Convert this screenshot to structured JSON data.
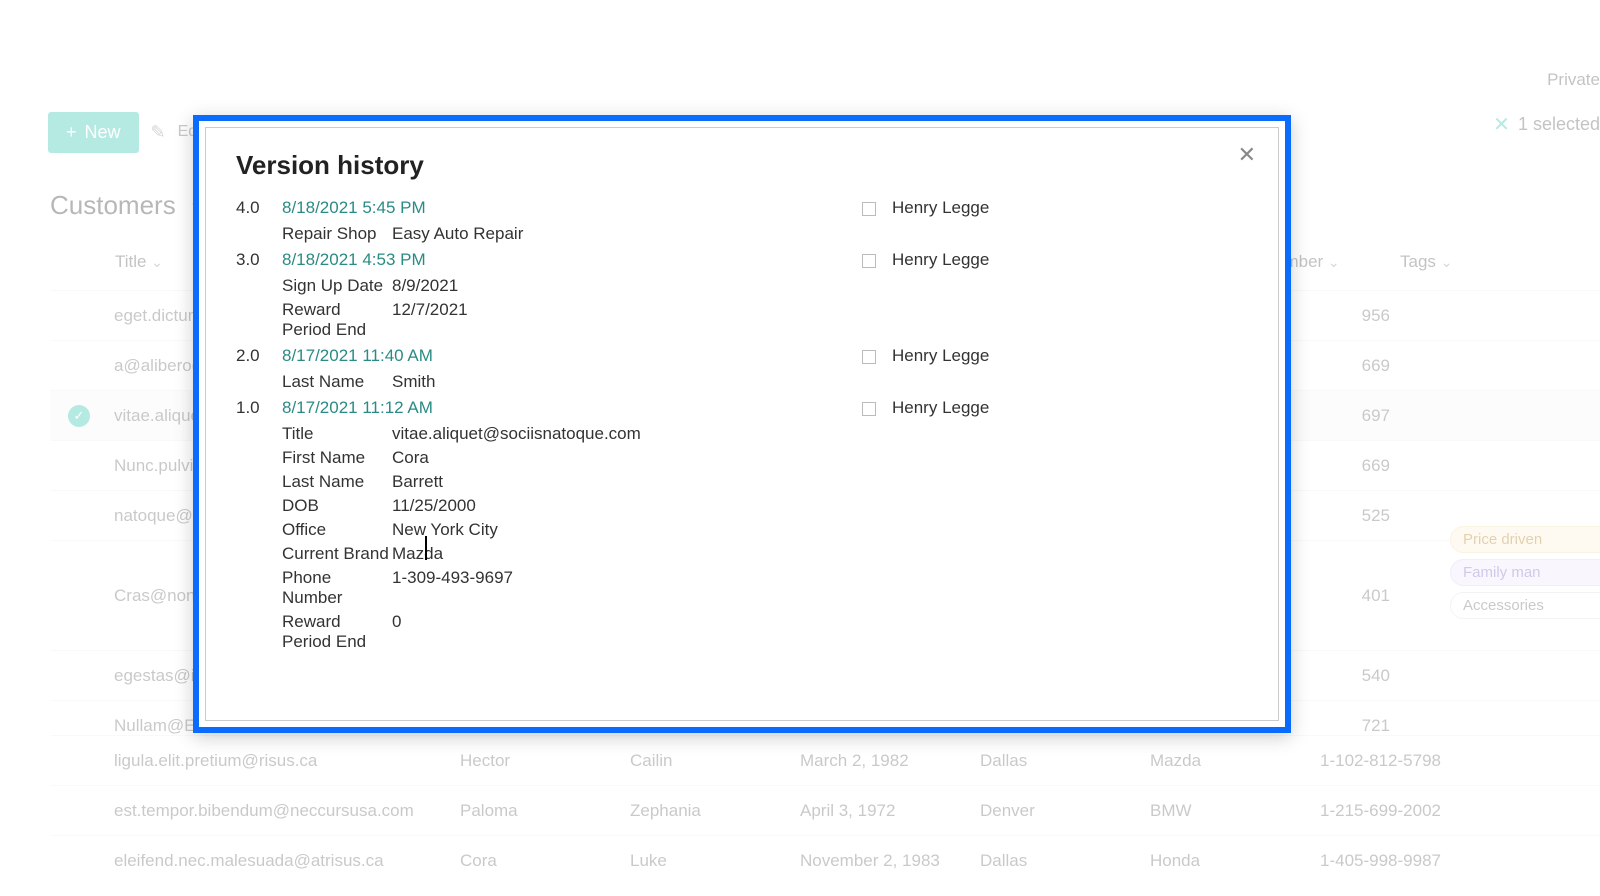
{
  "topbar": {
    "right_label": "Private"
  },
  "toolbar": {
    "new_label": "New",
    "edit_label": "Edit",
    "selection_info": "1 selected"
  },
  "list": {
    "title": "Customers"
  },
  "columns": {
    "title": "Title",
    "number_partial": "umber",
    "tags": "Tags"
  },
  "rows": [
    {
      "title": "eget.dictum.p",
      "num": "956"
    },
    {
      "title": "a@aliberod.c",
      "num": "669"
    },
    {
      "title": "vitae.aliquet",
      "num": "697",
      "selected": true
    },
    {
      "title": "Nunc.pulvin",
      "num": "669"
    },
    {
      "title": "natoque@ve",
      "num": "525"
    },
    {
      "title": "Cras@non.ac",
      "num": "401",
      "tags": [
        {
          "text": "Price driven",
          "style": "orange"
        },
        {
          "text": "Family man",
          "style": "purple"
        },
        {
          "text": "Accessories",
          "style": "plain"
        }
      ]
    },
    {
      "title": "egestas@in.e",
      "num": "540"
    },
    {
      "title": "Nullam@Etia",
      "num": "721"
    }
  ],
  "bottom_rows": [
    {
      "title": "ligula.elit.pretium@risus.ca",
      "fn": "Hector",
      "ln": "Cailin",
      "dob": "March 2, 1982",
      "office": "Dallas",
      "brand": "Mazda",
      "phone": "1-102-812-5798"
    },
    {
      "title": "est.tempor.bibendum@neccursusa.com",
      "fn": "Paloma",
      "ln": "Zephania",
      "dob": "April 3, 1972",
      "office": "Denver",
      "brand": "BMW",
      "phone": "1-215-699-2002"
    },
    {
      "title": "eleifend.nec.malesuada@atrisus.ca",
      "fn": "Cora",
      "ln": "Luke",
      "dob": "November 2, 1983",
      "office": "Dallas",
      "brand": "Honda",
      "phone": "1-405-998-9987"
    }
  ],
  "modal": {
    "title": "Version history",
    "versions": [
      {
        "num": "4.0",
        "date": "8/18/2021 5:45 PM",
        "user": "Henry Legge",
        "details": [
          {
            "label": "Repair Shop",
            "value": "Easy Auto Repair",
            "link": true
          }
        ]
      },
      {
        "num": "3.0",
        "date": "8/18/2021 4:53 PM",
        "user": "Henry Legge",
        "details": [
          {
            "label": "Sign Up Date",
            "value": "8/9/2021"
          },
          {
            "label": "Reward Period End",
            "value": "12/7/2021"
          }
        ]
      },
      {
        "num": "2.0",
        "date": "8/17/2021 11:40 AM",
        "user": "Henry Legge",
        "details": [
          {
            "label": "Last Name",
            "value": "Smith"
          }
        ]
      },
      {
        "num": "1.0",
        "date": "8/17/2021 11:12 AM",
        "user": "Henry Legge",
        "details": [
          {
            "label": "Title",
            "value": "vitae.aliquet@sociisnatoque.com"
          },
          {
            "label": "First Name",
            "value": "Cora"
          },
          {
            "label": "Last Name",
            "value": "Barrett"
          },
          {
            "label": "DOB",
            "value": "11/25/2000"
          },
          {
            "label": "Office",
            "value": "New York City"
          },
          {
            "label": "Current Brand",
            "value": "Mazda"
          },
          {
            "label": "Phone Number",
            "value": "1-309-493-9697"
          },
          {
            "label": "Reward Period End",
            "value": "0"
          }
        ]
      }
    ]
  }
}
